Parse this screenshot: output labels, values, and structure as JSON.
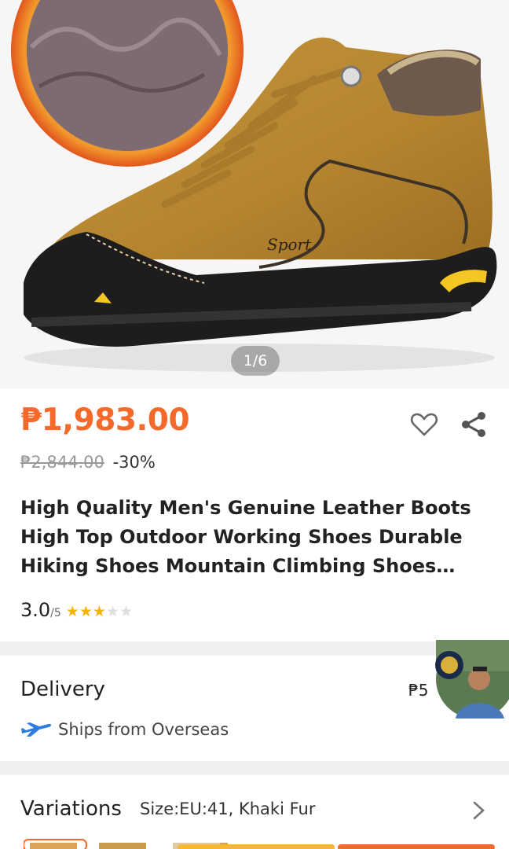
{
  "gallery": {
    "counter": "1/6",
    "logo_text": "Sport"
  },
  "product": {
    "price": "₱1,983.00",
    "original_price": "₱2,844.00",
    "discount": "-30%",
    "title": "High Quality Men's Genuine Leather Boots High Top Outdoor Working Shoes Durable Hiking Shoes Mountain Climbing Shoes Trek...",
    "rating_value": "3.0",
    "rating_max": "/5",
    "stars_filled": 3,
    "stars_total": 5
  },
  "delivery": {
    "title": "Delivery",
    "fee_partial": "₱5",
    "ships_from": "Ships from Overseas"
  },
  "variations": {
    "title": "Variations",
    "selected": "Size:EU:41, Khaki Fur"
  },
  "colors": {
    "price": "#f56a2a",
    "star_on": "#f5b400",
    "star_off": "#dedede",
    "plane": "#2f7be0"
  }
}
